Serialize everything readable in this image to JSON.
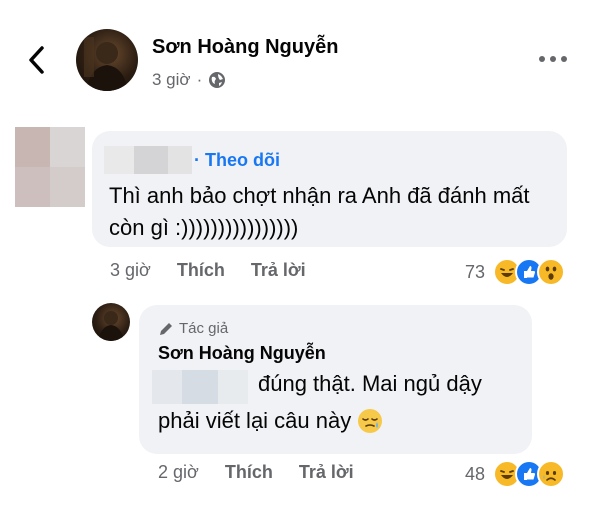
{
  "header": {
    "author_name": "Sơn Hoàng Nguyễn",
    "time": "3 giờ",
    "separator": "·",
    "privacy_icon": "globe-icon",
    "more_icon": "more-horizontal-icon",
    "back_icon": "chevron-left-icon"
  },
  "comment": {
    "follow_label": "Theo dõi",
    "text": "Thì anh bảo chợt nhận ra Anh đã đánh mất còn gì :))))))))))))))))",
    "time": "3 giờ",
    "like_label": "Thích",
    "reply_label": "Trả lời",
    "reaction_count": "73",
    "reactions": [
      "haha",
      "like",
      "wow"
    ]
  },
  "reply": {
    "author_badge": "Tác giả",
    "author_name": "Sơn Hoàng Nguyễn",
    "text_line1": "đúng thật. Mai ngủ dậy",
    "text_line2": "phải viết lại câu này",
    "emoji": "sleepy-face-emoji",
    "time": "2 giờ",
    "like_label": "Thích",
    "reply_label": "Trả lời",
    "reaction_count": "48",
    "reactions": [
      "haha",
      "like",
      "sad"
    ]
  },
  "colors": {
    "link_blue": "#1877f2",
    "muted_gray": "#65676b",
    "bubble_bg": "#f0f2f5",
    "like_blue": "#1877f2",
    "haha_yellow": "#f7b928"
  }
}
